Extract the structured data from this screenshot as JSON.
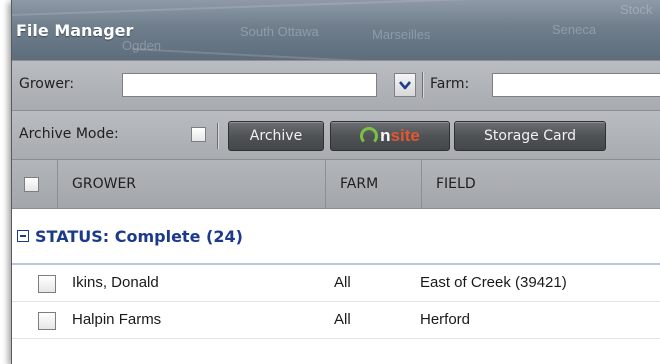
{
  "window": {
    "title": "File Manager"
  },
  "map_labels": [
    "South Ottawa",
    "Marseilles",
    "Seneca",
    "Ogden",
    "Stock"
  ],
  "filters": {
    "grower_label": "Grower:",
    "grower_value": "",
    "farm_label": "Farm:",
    "farm_value": ""
  },
  "actions": {
    "archive_mode_label": "Archive Mode:",
    "archive_button": "Archive",
    "onsite_o": "",
    "onsite_n": "n",
    "onsite_site": "site",
    "storage_card_button": "Storage Card"
  },
  "columns": [
    "GROWER",
    "FARM",
    "FIELD"
  ],
  "group": {
    "label": "STATUS: Complete (24)"
  },
  "rows": [
    {
      "grower": "Ikins, Donald",
      "farm": "All",
      "field": "East of Creek (39421)"
    },
    {
      "grower": "Halpin Farms",
      "farm": "All",
      "field": "Herford"
    }
  ],
  "colors": {
    "group_text": "#1b3a8c",
    "onsite_green": "#7cc242",
    "onsite_orange": "#e4572e"
  },
  "icons": {
    "dropdown": "chevron-down-icon",
    "collapse": "minus-box-icon"
  }
}
